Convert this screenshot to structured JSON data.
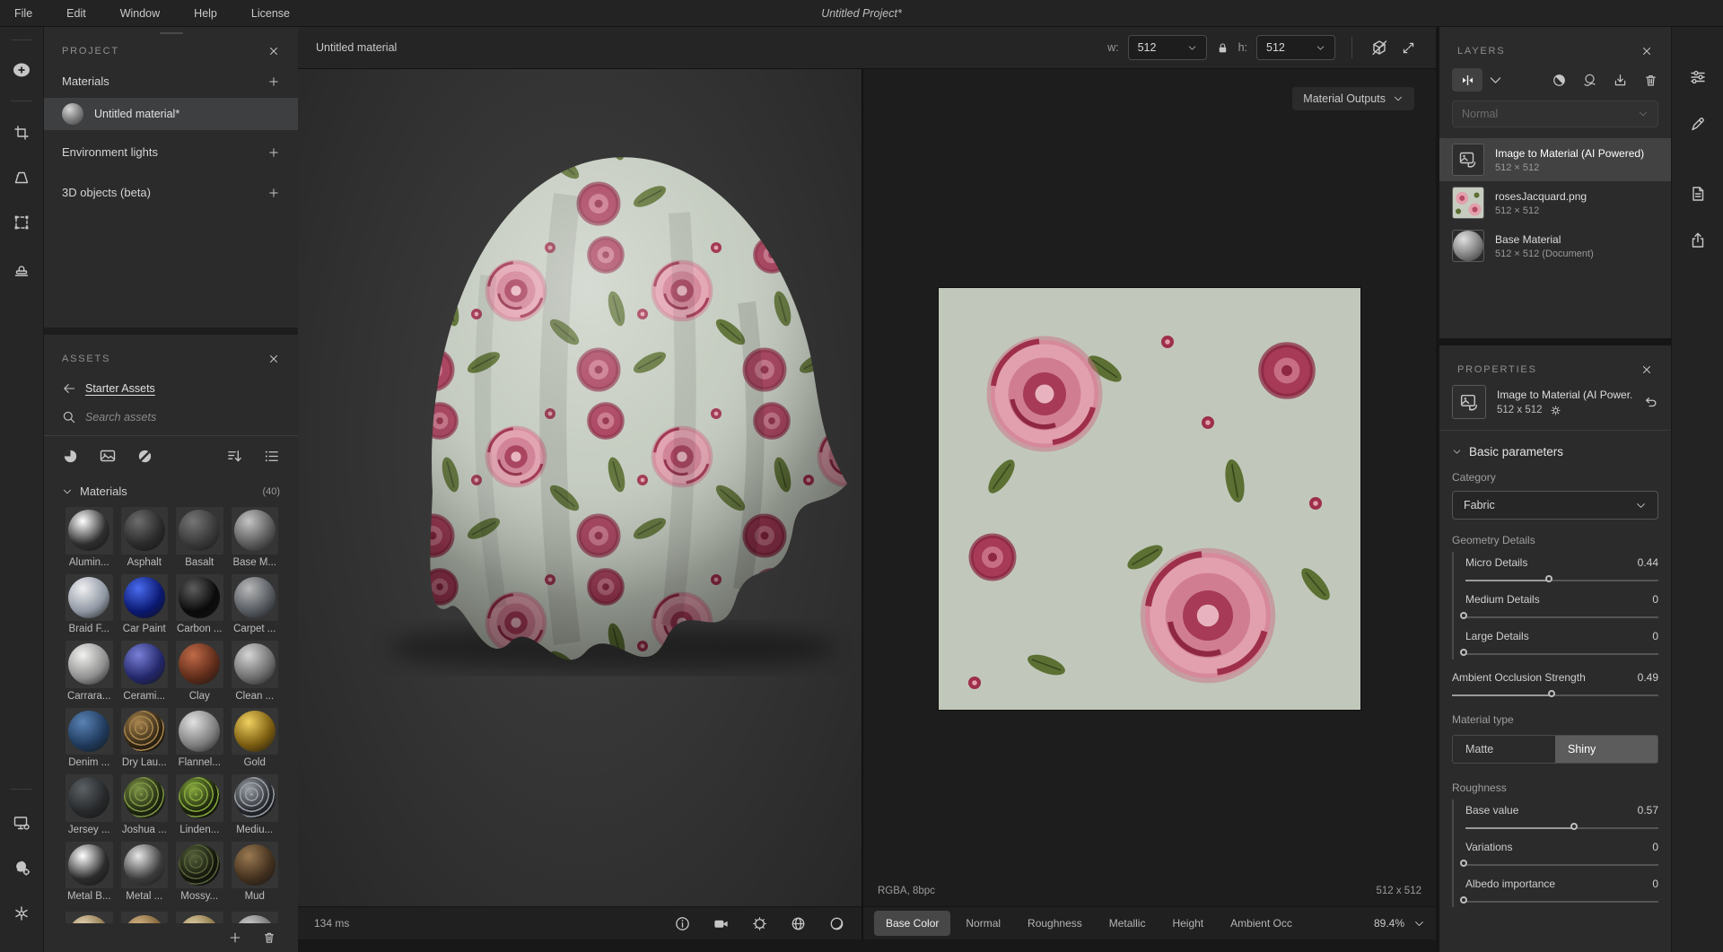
{
  "window": {
    "title": "Untitled Project*"
  },
  "menu": {
    "items": [
      "File",
      "Edit",
      "Window",
      "Help",
      "License"
    ]
  },
  "left_toolbar": {
    "icons": [
      "add",
      "crop",
      "perspective-correction",
      "tiling",
      "clone-stamp",
      "display-settings",
      "viewer-settings",
      "preferences"
    ]
  },
  "right_toolbar": {
    "icons": [
      "adjustments",
      "marker",
      "notes",
      "share"
    ]
  },
  "project_panel": {
    "title": "PROJECT",
    "materials_label": "Materials",
    "material_item": "Untitled material*",
    "environment_label": "Environment lights",
    "objects_label": "3D objects (beta)"
  },
  "assets_panel": {
    "title": "ASSETS",
    "back_link": "Starter Assets",
    "search_placeholder": "Search assets",
    "section_label": "Materials",
    "section_count": "(40)",
    "items": [
      {
        "name": "Alumin...",
        "c1": "#ffffff",
        "c2": "#2e2e2e"
      },
      {
        "name": "Asphalt",
        "c1": "#6d6d6d",
        "c2": "#2a2a2a"
      },
      {
        "name": "Basalt",
        "c1": "#757575",
        "c2": "#383838"
      },
      {
        "name": "Base M...",
        "c1": "#c4c4c4",
        "c2": "#5a5a5a"
      },
      {
        "name": "Braid F...",
        "c1": "#f0f0f2",
        "c2": "#8f97a3"
      },
      {
        "name": "Car Paint",
        "c1": "#4a6cf0",
        "c2": "#0a1870"
      },
      {
        "name": "Carbon ...",
        "c1": "#5d5d5d",
        "c2": "#0a0a0a"
      },
      {
        "name": "Carpet ...",
        "c1": "#b8b8b8",
        "c2": "#555a60"
      },
      {
        "name": "Carrara...",
        "c1": "#f2f2f0",
        "c2": "#8f8f8f"
      },
      {
        "name": "Cerami...",
        "c1": "#7a80d8",
        "c2": "#23276a"
      },
      {
        "name": "Clay",
        "c1": "#c06a48",
        "c2": "#5f2c1a"
      },
      {
        "name": "Clean ...",
        "c1": "#d5d5d5",
        "c2": "#6e6e6e"
      },
      {
        "name": "Denim ...",
        "c1": "#5a83b5",
        "c2": "#1f3a5c"
      },
      {
        "name": "Dry Lau...",
        "c1": "#a8854e",
        "c2": "#2e2312",
        "dots": true
      },
      {
        "name": "Flannel...",
        "c1": "#e2e2e2",
        "c2": "#7d7d7d"
      },
      {
        "name": "Gold",
        "c1": "#f0d060",
        "c2": "#7a5c10"
      },
      {
        "name": "Jersey ...",
        "c1": "#5c6165",
        "c2": "#26282a"
      },
      {
        "name": "Joshua ...",
        "c1": "#7d9445",
        "c2": "#1c240e",
        "dots": true
      },
      {
        "name": "Linden...",
        "c1": "#86a83e",
        "c2": "#18200a",
        "dots": true
      },
      {
        "name": "Mediu...",
        "c1": "#9aa0a6",
        "c2": "#23252a",
        "dots": true
      },
      {
        "name": "Metal B...",
        "c1": "#ffffff",
        "c2": "#2b2b2b"
      },
      {
        "name": "Metal ...",
        "c1": "#e8e8e8",
        "c2": "#3c3c3c"
      },
      {
        "name": "Mossy...",
        "c1": "#55603a",
        "c2": "#12150a",
        "dots": true
      },
      {
        "name": "Mud",
        "c1": "#9a7a52",
        "c2": "#43301e"
      }
    ],
    "partial_items": [
      {
        "c1": "#e8d8b8",
        "c2": "#8a7348"
      },
      {
        "c1": "#d8b888",
        "c2": "#7a5c32"
      },
      {
        "c1": "#e0d0a8",
        "c2": "#857040"
      },
      {
        "c1": "#d0d0d0",
        "c2": "#6e6e6e"
      }
    ]
  },
  "header": {
    "tab_title": "Untitled material",
    "w_label": "w:",
    "w_value": "512",
    "h_label": "h:",
    "h_value": "512"
  },
  "viewport3d": {
    "render_time": "134 ms",
    "icons": [
      "info",
      "camera",
      "environment",
      "navigation-globe",
      "render-sphere"
    ]
  },
  "view2d": {
    "outputs_dropdown": "Material Outputs",
    "format": "RGBA, 8bpc",
    "size": "512 x 512",
    "zoom": "89.4%",
    "channels": [
      {
        "label": "Base Color",
        "active": true
      },
      {
        "label": "Normal"
      },
      {
        "label": "Roughness"
      },
      {
        "label": "Metallic"
      },
      {
        "label": "Height"
      },
      {
        "label": "Ambient Occ"
      }
    ]
  },
  "layers_panel": {
    "title": "LAYERS",
    "blend_mode": "Normal",
    "toolbar_icons": [
      "split-view",
      "adjustment",
      "effect",
      "import",
      "delete"
    ],
    "items": [
      {
        "name": "Image to Material (AI Powered)",
        "size": "512 × 512",
        "selected": true
      },
      {
        "name": "rosesJacquard.png",
        "size": "512 × 512"
      },
      {
        "name": "Base Material",
        "size": "512 × 512 (Document)"
      }
    ]
  },
  "properties_panel": {
    "title": "PROPERTIES",
    "layer_name": "Image to Material (AI Power...",
    "layer_size": "512 x 512",
    "section": "Basic parameters",
    "category_label": "Category",
    "category_value": "Fabric",
    "geometry_label": "Geometry Details",
    "material_type_label": "Material type",
    "material_type_options": [
      "Matte",
      "Shiny"
    ],
    "material_type_selected": "Shiny",
    "roughness_label": "Roughness",
    "sliders": {
      "micro": {
        "label": "Micro Details",
        "value": "0.44",
        "pct": 44
      },
      "medium": {
        "label": "Medium Details",
        "value": "0",
        "pct": 0
      },
      "large": {
        "label": "Large Details",
        "value": "0",
        "pct": 0
      },
      "ao": {
        "label": "Ambient Occlusion Strength",
        "value": "0.49",
        "pct": 49
      },
      "base": {
        "label": "Base value",
        "value": "0.57",
        "pct": 57
      },
      "variations": {
        "label": "Variations",
        "value": "0",
        "pct": 0
      },
      "albedo": {
        "label": "Albedo importance",
        "value": "0",
        "pct": 0
      }
    },
    "colors": {
      "panel_bg": "#2b2b2b",
      "selection": "#424242",
      "fabric_base": "#c6cdc0",
      "rose_pink": "#e2a0ae",
      "rose_crimson": "#9e2f4a",
      "leaf_green": "#5c7033"
    }
  }
}
